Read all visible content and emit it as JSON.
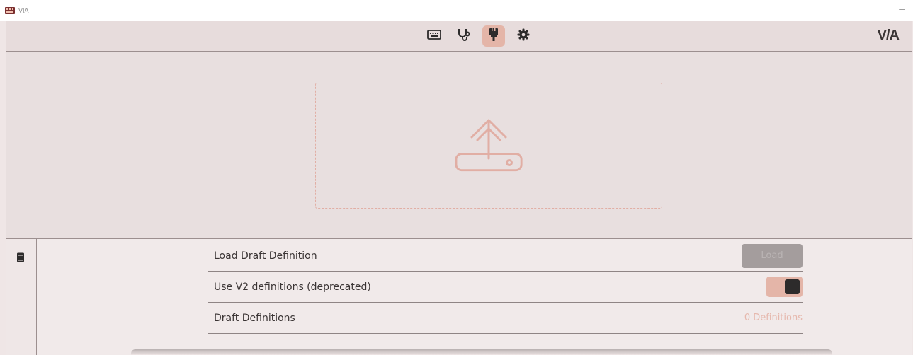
{
  "window": {
    "title": "VIA",
    "minimize_label": "–"
  },
  "navbar": {
    "icons": [
      "keyboard-icon",
      "stethoscope-icon",
      "design-brush-icon",
      "gear-icon"
    ],
    "active_icon": "design-brush-icon",
    "brand": "V/A"
  },
  "dropzone": {
    "icon": "upload-icon"
  },
  "settings": {
    "rail_icon": "book-icon",
    "rows": [
      {
        "label": "Load Draft Definition",
        "control": "button",
        "button_label": "Load"
      },
      {
        "label": "Use V2 definitions (deprecated)",
        "control": "toggle",
        "toggle_on": true
      },
      {
        "label": "Draft Definitions",
        "control": "text",
        "value": "0 Definitions"
      }
    ]
  },
  "colors": {
    "accent": "#e4b5a8",
    "background": "#efe6e6",
    "text": "#3a3434",
    "border": "#9c8f8f"
  }
}
